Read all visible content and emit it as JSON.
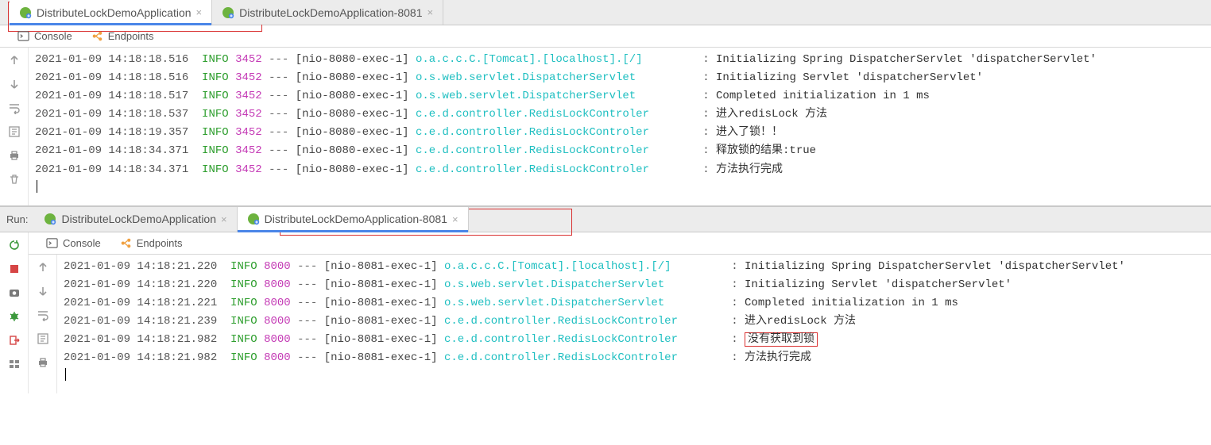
{
  "pane1": {
    "tabs": [
      {
        "label": "DistributeLockDemoApplication"
      },
      {
        "label": "DistributeLockDemoApplication-8081"
      }
    ],
    "subtabs": {
      "console": "Console",
      "endpoints": "Endpoints"
    },
    "logs": [
      {
        "ts": "2021-01-09 14:18:18.516",
        "lvl": "INFO",
        "pid": "3452",
        "thr": "[nio-8080-exec-1]",
        "logger": "o.a.c.c.C.[Tomcat].[localhost].[/]",
        "msg": "Initializing Spring DispatcherServlet 'dispatcherServlet'"
      },
      {
        "ts": "2021-01-09 14:18:18.516",
        "lvl": "INFO",
        "pid": "3452",
        "thr": "[nio-8080-exec-1]",
        "logger": "o.s.web.servlet.DispatcherServlet",
        "msg": "Initializing Servlet 'dispatcherServlet'"
      },
      {
        "ts": "2021-01-09 14:18:18.517",
        "lvl": "INFO",
        "pid": "3452",
        "thr": "[nio-8080-exec-1]",
        "logger": "o.s.web.servlet.DispatcherServlet",
        "msg": "Completed initialization in 1 ms"
      },
      {
        "ts": "2021-01-09 14:18:18.537",
        "lvl": "INFO",
        "pid": "3452",
        "thr": "[nio-8080-exec-1]",
        "logger": "c.e.d.controller.RedisLockControler",
        "msg": "进入redisLock 方法"
      },
      {
        "ts": "2021-01-09 14:18:19.357",
        "lvl": "INFO",
        "pid": "3452",
        "thr": "[nio-8080-exec-1]",
        "logger": "c.e.d.controller.RedisLockControler",
        "msg": "进入了锁！！"
      },
      {
        "ts": "2021-01-09 14:18:34.371",
        "lvl": "INFO",
        "pid": "3452",
        "thr": "[nio-8080-exec-1]",
        "logger": "c.e.d.controller.RedisLockControler",
        "msg": "释放锁的结果:true"
      },
      {
        "ts": "2021-01-09 14:18:34.371",
        "lvl": "INFO",
        "pid": "3452",
        "thr": "[nio-8080-exec-1]",
        "logger": "c.e.d.controller.RedisLockControler",
        "msg": "方法执行完成"
      }
    ]
  },
  "pane2": {
    "run_label": "Run:",
    "tabs": [
      {
        "label": "DistributeLockDemoApplication"
      },
      {
        "label": "DistributeLockDemoApplication-8081"
      }
    ],
    "subtabs": {
      "console": "Console",
      "endpoints": "Endpoints"
    },
    "logs": [
      {
        "ts": "2021-01-09 14:18:21.220",
        "lvl": "INFO",
        "pid": "8000",
        "thr": "[nio-8081-exec-1]",
        "logger": "o.a.c.c.C.[Tomcat].[localhost].[/]",
        "msg": "Initializing Spring DispatcherServlet 'dispatcherServlet'"
      },
      {
        "ts": "2021-01-09 14:18:21.220",
        "lvl": "INFO",
        "pid": "8000",
        "thr": "[nio-8081-exec-1]",
        "logger": "o.s.web.servlet.DispatcherServlet",
        "msg": "Initializing Servlet 'dispatcherServlet'"
      },
      {
        "ts": "2021-01-09 14:18:21.221",
        "lvl": "INFO",
        "pid": "8000",
        "thr": "[nio-8081-exec-1]",
        "logger": "o.s.web.servlet.DispatcherServlet",
        "msg": "Completed initialization in 1 ms"
      },
      {
        "ts": "2021-01-09 14:18:21.239",
        "lvl": "INFO",
        "pid": "8000",
        "thr": "[nio-8081-exec-1]",
        "logger": "c.e.d.controller.RedisLockControler",
        "msg": "进入redisLock 方法"
      },
      {
        "ts": "2021-01-09 14:18:21.982",
        "lvl": "INFO",
        "pid": "8000",
        "thr": "[nio-8081-exec-1]",
        "logger": "c.e.d.controller.RedisLockControler",
        "msg": "没有获取到锁",
        "boxed": true
      },
      {
        "ts": "2021-01-09 14:18:21.982",
        "lvl": "INFO",
        "pid": "8000",
        "thr": "[nio-8081-exec-1]",
        "logger": "c.e.d.controller.RedisLockControler",
        "msg": "方法执行完成"
      }
    ]
  },
  "col": {
    "dash": "---",
    "sep": ": ",
    "loggerPad": 40,
    "msgCol": 66
  }
}
